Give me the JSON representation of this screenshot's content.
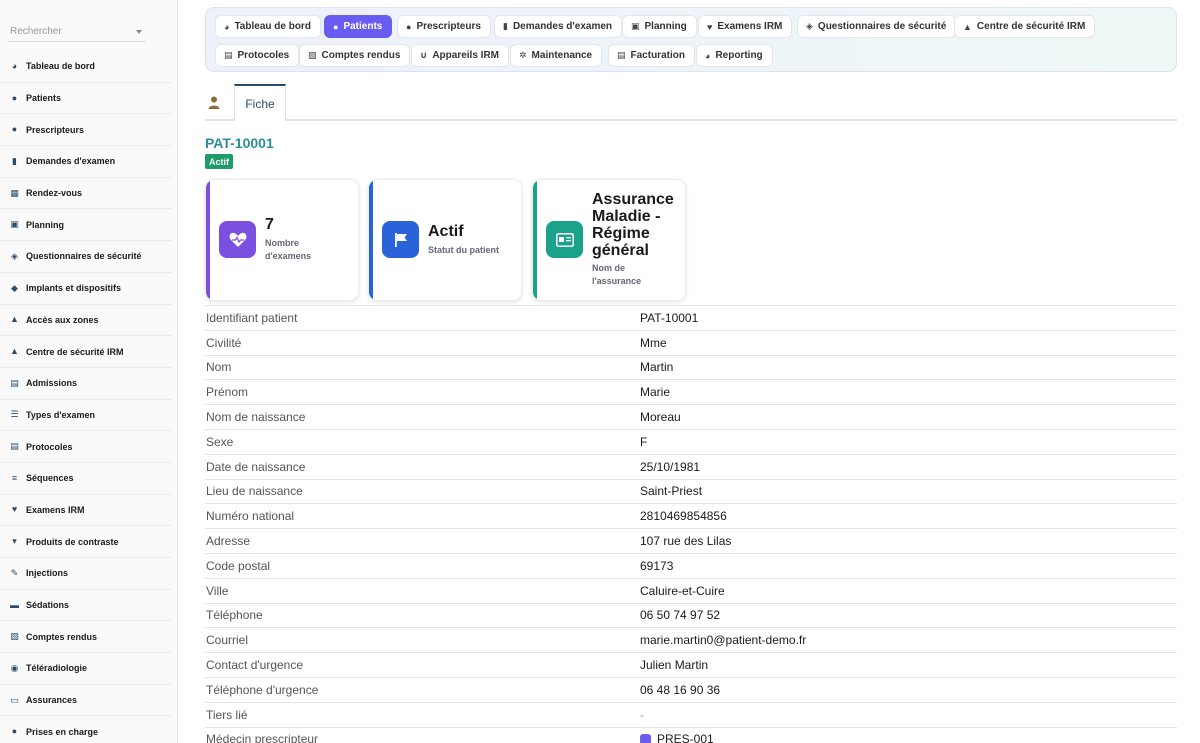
{
  "search": {
    "placeholder": "Rechercher"
  },
  "sidebar": {
    "items": [
      {
        "label": "Tableau de bord",
        "icon": "dashboard-icon"
      },
      {
        "label": "Patients",
        "icon": "user-icon"
      },
      {
        "label": "Prescripteurs",
        "icon": "user-doctor-icon"
      },
      {
        "label": "Demandes d'examen",
        "icon": "file-icon"
      },
      {
        "label": "Rendez-vous",
        "icon": "calendar-icon"
      },
      {
        "label": "Planning",
        "icon": "calendar-check-icon"
      },
      {
        "label": "Questionnaires de sécurité",
        "icon": "shield-icon"
      },
      {
        "label": "Implants et dispositifs",
        "icon": "cube-icon"
      },
      {
        "label": "Accès aux zones",
        "icon": "lock-icon"
      },
      {
        "label": "Centre de sécurité IRM",
        "icon": "warning-icon"
      },
      {
        "label": "Admissions",
        "icon": "clipboard-icon"
      },
      {
        "label": "Types d'examen",
        "icon": "list-icon"
      },
      {
        "label": "Protocoles",
        "icon": "clipboard-list-icon"
      },
      {
        "label": "Séquences",
        "icon": "lines-icon"
      },
      {
        "label": "Examens IRM",
        "icon": "heart-pulse-icon"
      },
      {
        "label": "Produits de contraste",
        "icon": "flask-icon"
      },
      {
        "label": "Injections",
        "icon": "syringe-icon"
      },
      {
        "label": "Sédations",
        "icon": "bed-icon"
      },
      {
        "label": "Comptes rendus",
        "icon": "report-icon"
      },
      {
        "label": "Téléradiologie",
        "icon": "satellite-icon"
      },
      {
        "label": "Assurances",
        "icon": "id-card-icon"
      },
      {
        "label": "Prises en charge",
        "icon": "circle-icon"
      }
    ]
  },
  "toolbar": {
    "buttons": [
      {
        "label": "Tableau de bord",
        "icon": "dashboard-icon"
      },
      {
        "label": "Patients",
        "icon": "user-icon",
        "active": true
      },
      {
        "label": "Prescripteurs",
        "icon": "user-doctor-icon"
      },
      {
        "label": "Demandes d'examen",
        "icon": "file-icon"
      },
      {
        "label": "Planning",
        "icon": "calendar-check-icon"
      },
      {
        "label": "Examens IRM",
        "icon": "heart-pulse-icon"
      },
      {
        "label": "Questionnaires de sécurité",
        "icon": "shield-icon"
      },
      {
        "label": "Centre de sécurité IRM",
        "icon": "warning-icon"
      },
      {
        "label": "Protocoles",
        "icon": "clipboard-list-icon"
      },
      {
        "label": "Comptes rendus",
        "icon": "report-icon"
      },
      {
        "label": "Appareils IRM",
        "icon": "magnet-icon"
      },
      {
        "label": "Maintenance",
        "icon": "gears-icon"
      },
      {
        "label": "Facturation",
        "icon": "invoice-icon"
      },
      {
        "label": "Reporting",
        "icon": "chart-pie-icon"
      }
    ]
  },
  "tabs": {
    "fiche": "Fiche"
  },
  "patient": {
    "id": "PAT-10001",
    "status": "Actif"
  },
  "cards": [
    {
      "value": "7",
      "label": "Nombre d'examens",
      "color": "#7b4fe0",
      "icon": "heart-pulse-icon"
    },
    {
      "value": "Actif",
      "label": "Statut du patient",
      "color": "#2a62d9",
      "icon": "flag-icon"
    },
    {
      "value": "Assurance Maladie - Régime général",
      "label": "Nom de l'assurance",
      "color": "#1aa38a",
      "icon": "id-card-icon"
    }
  ],
  "details": [
    {
      "label": "Identifiant patient",
      "value": "PAT-10001"
    },
    {
      "label": "Civilité",
      "value": "Mme"
    },
    {
      "label": "Nom",
      "value": "Martin"
    },
    {
      "label": "Prénom",
      "value": "Marie"
    },
    {
      "label": "Nom de naissance",
      "value": "Moreau"
    },
    {
      "label": "Sexe",
      "value": "F"
    },
    {
      "label": "Date de naissance",
      "value": "25/10/1981"
    },
    {
      "label": "Lieu de naissance",
      "value": "Saint-Priest"
    },
    {
      "label": "Numéro national",
      "value": "2810469854856"
    },
    {
      "label": "Adresse",
      "value": "107 rue des Lilas"
    },
    {
      "label": "Code postal",
      "value": "69173"
    },
    {
      "label": "Ville",
      "value": "Caluire-et-Cuire"
    },
    {
      "label": "Téléphone",
      "value": "06 50 74 97 52"
    },
    {
      "label": "Courriel",
      "value": "marie.martin0@patient-demo.fr"
    },
    {
      "label": "Contact d'urgence",
      "value": "Julien Martin"
    },
    {
      "label": "Téléphone d'urgence",
      "value": "06 48 16 90 36"
    },
    {
      "label": "Tiers lié",
      "value": "-"
    },
    {
      "label": "Médecin prescripteur",
      "value": "PRES-001"
    }
  ]
}
